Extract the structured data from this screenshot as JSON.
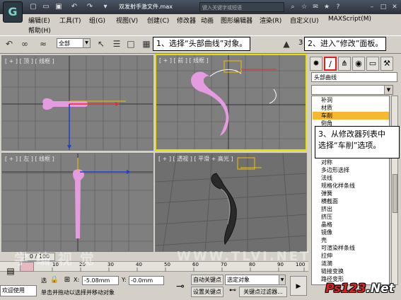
{
  "window": {
    "title": "双发射手激文件.max",
    "search_placeholder": "键入关键字或短语"
  },
  "menu": {
    "items": [
      "编辑(E)",
      "工具(T)",
      "组(G)",
      "视图(V)",
      "创建(C)",
      "修改器",
      "动画",
      "图形编辑器",
      "渲染(R)",
      "自定义(U)",
      "MAXScript(M)",
      "帮助(H)"
    ]
  },
  "toolbar": {
    "selection_filter": "全部",
    "view_number": "3"
  },
  "callouts": {
    "step1": "1、选择“头部曲线”对象。",
    "step2": "2、进入“修改”面板。",
    "step3_line1": "3、从修改器列表中",
    "step3_line2": "选择“车削”选项。"
  },
  "viewports": {
    "top": "[ + ] [ 顶 ] [ 线框 ]",
    "front": "[ + ] [ 前 ] [ 线框 ]",
    "left": "[ + ] [ 左 ] [ 线框 ]",
    "perspective": "[ + ] [ 透视 ] [ 平滑 + 高光 ]"
  },
  "command_panel": {
    "object_name": "头部曲线",
    "modifiers": [
      "补洞",
      "材质",
      "车削",
      "倒角",
      "对称",
      "多边形选择",
      "法线",
      "规格化样条线",
      "弹簧",
      "横截面",
      "挤出",
      "挤压",
      "晶格",
      "镜像",
      "壳",
      "可渲染样条线",
      "拉伸",
      "涟漪",
      "链接变换",
      "路径变形",
      "变形"
    ],
    "selected_modifier": "车削"
  },
  "status": {
    "timeline": "0 / 100",
    "selected_label": "选",
    "x_label": "X:",
    "x_value": "-5.08mm",
    "y_label": "Y:",
    "y_value": "-0.0mm",
    "auto_key": "自动关键点",
    "set_key": "设置关键点",
    "key_mode": "选定对象",
    "key_filters": "关键点过滤器...",
    "prompt_left": "欢迎使用",
    "prompt": "单击并拖动以选择并移动对象",
    "ticks": [
      "0",
      "10",
      "20",
      "30",
      "40",
      "50",
      "60",
      "70",
      "80",
      "90",
      "100"
    ]
  },
  "watermark": {
    "left": "学 编 视 觉",
    "center": "WWW.TLVI.NET",
    "brand": "Ps123",
    "brand_suffix": ".Net"
  },
  "colors": {
    "accent_orange": "#f5b830",
    "viewport_bg": "#7f7f7f",
    "shape_pink": "#e49be0",
    "active_border": "#e8e000"
  }
}
